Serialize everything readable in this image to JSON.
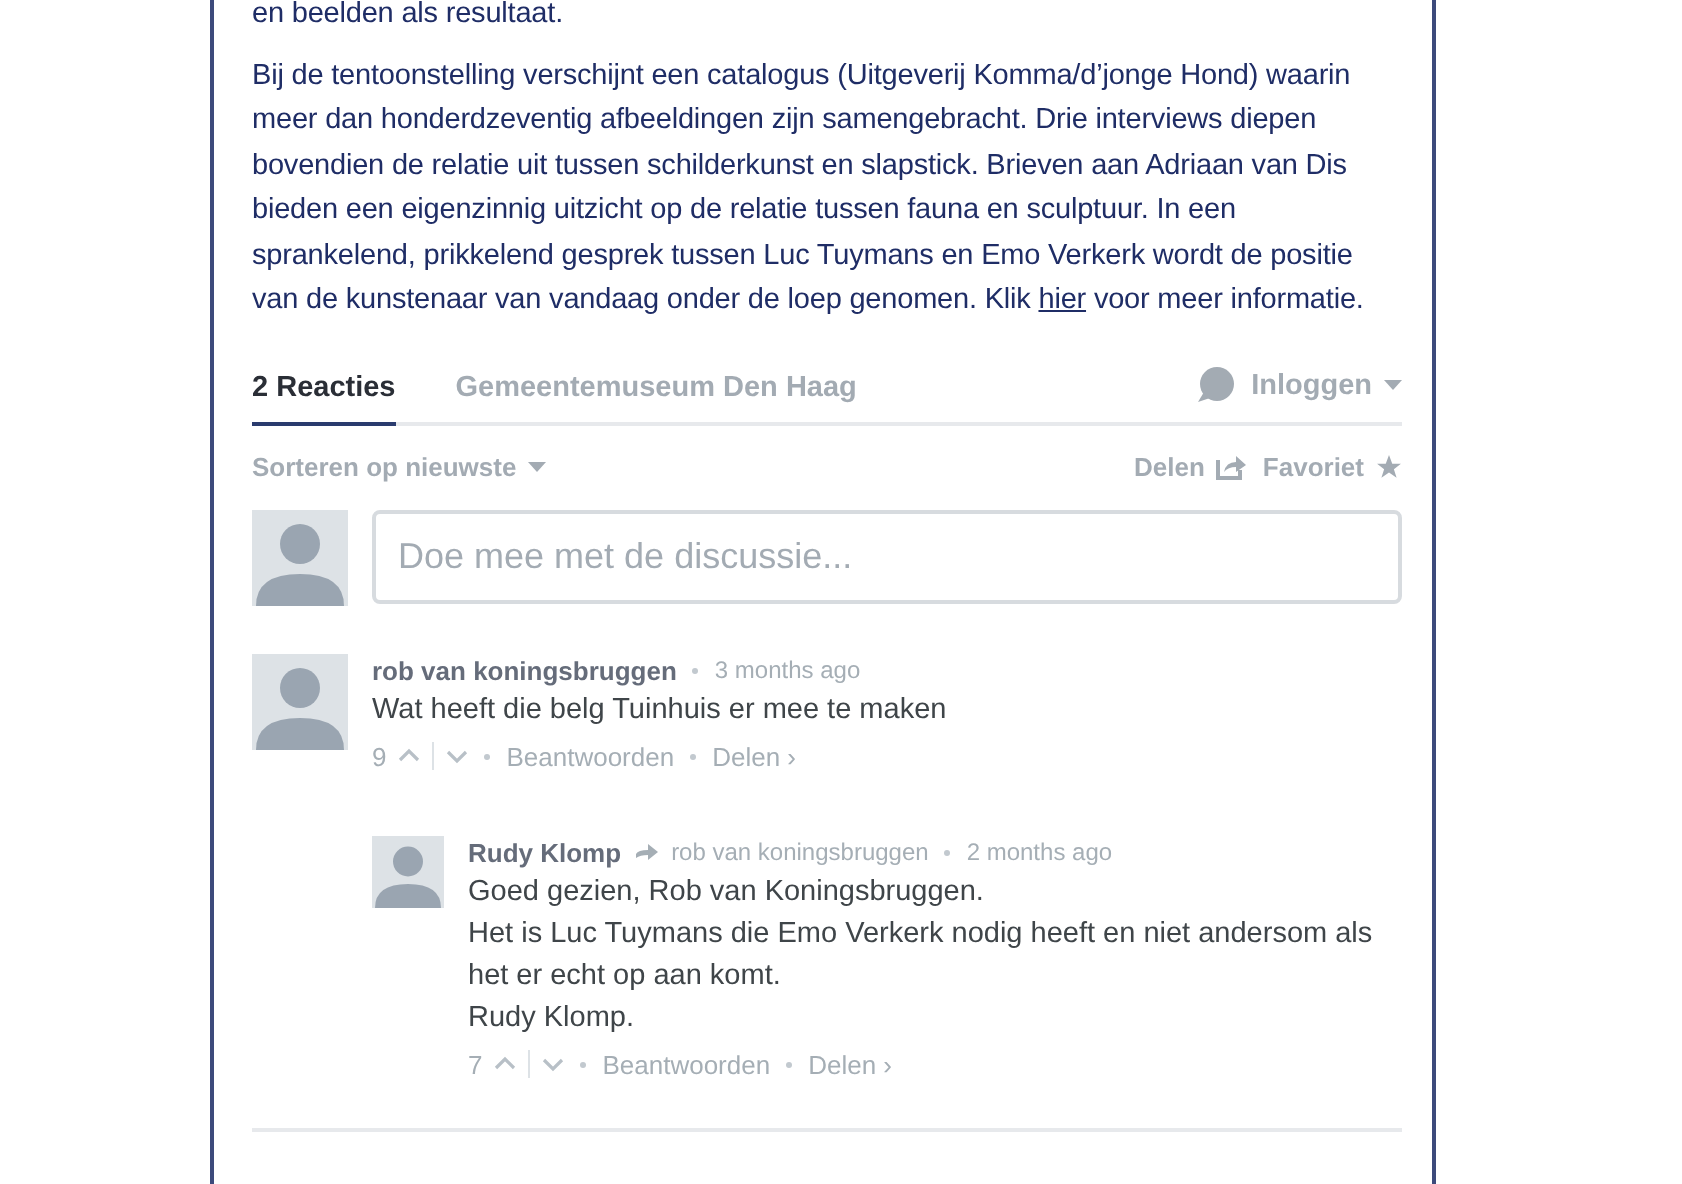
{
  "article": {
    "paragraphs": [
      {
        "text": "en beelden als resultaat."
      },
      {
        "text": "Bij de tentoonstelling verschijnt een catalogus (Uitgeverij Komma/d’jonge Hond) waarin meer dan honderdzeventig afbeeldingen zijn samengebracht. Drie interviews diepen bovendien de relatie uit tussen schilderkunst en slapstick. Brieven aan Adriaan van Dis bieden een eigenzinnig uitzicht op de relatie tussen fauna en sculptuur. In een sprankelend, prikkelend gesprek tussen Luc Tuymans en Emo Verkerk wordt de positie van de kunstenaar van vandaag onder de loep genomen. Klik ",
        "link": "hier",
        "after": " voor meer informatie."
      }
    ]
  },
  "discussion": {
    "tabs": [
      {
        "label": "2 Reacties",
        "selected": true
      },
      {
        "label": "Gemeentemuseum Den Haag",
        "selected": false
      }
    ],
    "login": "Inloggen",
    "sort": "Sorteren op nieuwste",
    "share": "Delen",
    "favorite": "Favoriet",
    "composer": {
      "placeholder": "Doe mee met de discussie..."
    },
    "comments": [
      {
        "author": "rob van koningsbruggen",
        "time": "3 months ago",
        "lines": [
          "Wat heeft die belg Tuinhuis er mee te maken"
        ],
        "votes": "9",
        "reply": "Beantwoorden",
        "share": "Delen ›",
        "children": [
          {
            "author": "Rudy Klomp",
            "reply_to": "rob van koningsbruggen",
            "time": "2 months ago",
            "lines": [
              "Goed gezien, Rob van Koningsbruggen.",
              "Het is Luc Tuymans die Emo Verkerk nodig heeft en niet andersom als het er echt op aan komt.",
              "Rudy Klomp."
            ],
            "votes": "7",
            "reply": "Beantwoorden",
            "share": "Delen ›"
          }
        ]
      }
    ]
  }
}
